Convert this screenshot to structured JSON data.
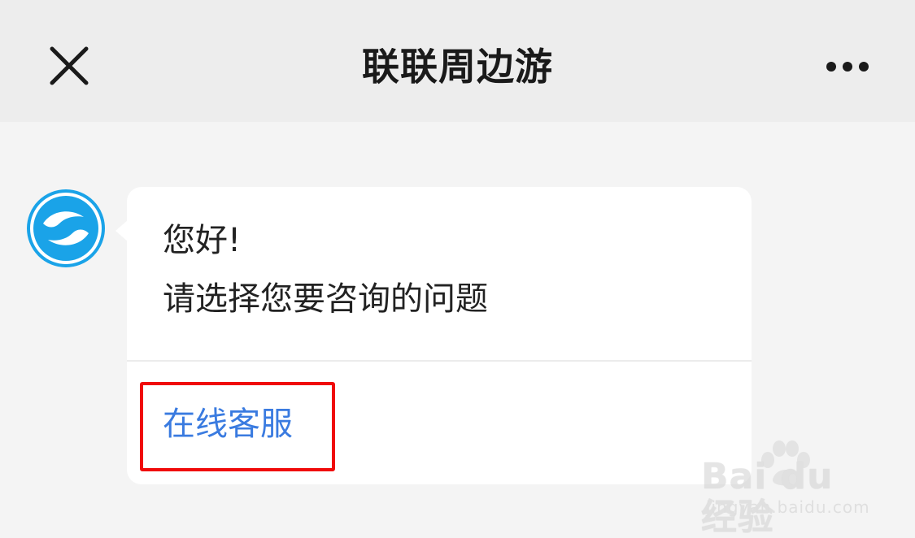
{
  "header": {
    "title": "联联周边游",
    "close_icon": "close-icon",
    "more_icon": "more-dots-icon"
  },
  "chat": {
    "avatar_icon": "lianlian-logo-icon",
    "greeting": "您好!",
    "prompt": "请选择您要咨询的问题",
    "options": [
      {
        "label": "在线客服"
      }
    ]
  },
  "watermark": {
    "brand": "Bai du 经验",
    "url": "jingyan.baidu.com"
  },
  "colors": {
    "header_bg": "#ededed",
    "page_bg": "#f4f4f4",
    "bubble_bg": "#ffffff",
    "link": "#3a7be0",
    "highlight": "#f00a0a",
    "avatar": "#1aa3e8"
  }
}
